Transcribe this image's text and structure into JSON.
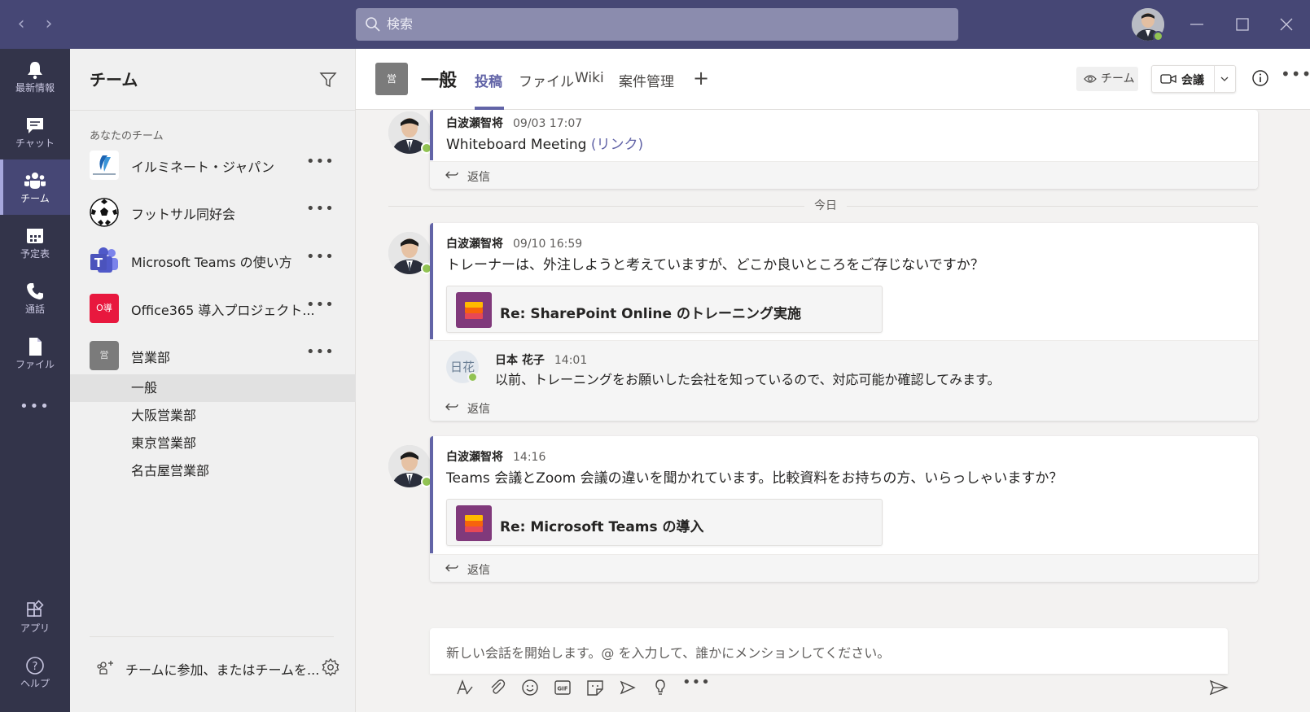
{
  "titlebar": {
    "search_placeholder": "検索"
  },
  "appbar": {
    "items": [
      {
        "label": "最新情報",
        "icon": "bell-icon"
      },
      {
        "label": "チャット",
        "icon": "chat-icon"
      },
      {
        "label": "チーム",
        "icon": "teams-icon"
      },
      {
        "label": "予定表",
        "icon": "calendar-icon"
      },
      {
        "label": "通話",
        "icon": "phone-icon"
      },
      {
        "label": "ファイル",
        "icon": "file-icon"
      }
    ],
    "more": "•••",
    "bottom": [
      {
        "label": "アプリ",
        "icon": "apps-icon"
      },
      {
        "label": "ヘルプ",
        "icon": "help-icon"
      }
    ]
  },
  "teams_panel": {
    "title": "チーム",
    "section_label": "あなたのチーム",
    "teams": [
      {
        "name": "イルミネート・ジャパン",
        "more": "•••"
      },
      {
        "name": "フットサル同好会",
        "more": "•••"
      },
      {
        "name": "Microsoft Teams の使い方",
        "more": "•••"
      },
      {
        "name": "Office365 導入プロジェクト...",
        "more": "•••",
        "logo_text": "O導"
      },
      {
        "name": "営業部",
        "more": "•••",
        "logo_text": "営"
      }
    ],
    "channels": [
      "一般",
      "大阪営業部",
      "東京営業部",
      "名古屋営業部"
    ],
    "join_text": "チームに参加、またはチームを..."
  },
  "channel_header": {
    "badge": "営",
    "name": "一般",
    "tabs": [
      "投稿",
      "ファイル",
      "Wiki",
      "案件管理"
    ],
    "add_tab": "+",
    "team_button": "チーム",
    "meet_button": "会議",
    "more": "•••"
  },
  "messages": {
    "date_separator": "今日",
    "reply_label": "返信",
    "posts": [
      {
        "author": "白波瀬智将",
        "time": "09/03 17:07",
        "text": "Whiteboard Meeting",
        "link": "(リンク)"
      },
      {
        "author": "白波瀬智将",
        "time": "09/10 16:59",
        "text": "トレーナーは、外注しようと考えていますが、どこか良いところをご存じないですか？",
        "attachment": "Re: SharePoint Online のトレーニング実施",
        "reply": {
          "author": "日本 花子",
          "time": "14:01",
          "avatar_text": "日花",
          "text": "以前、トレーニングをお願いした会社を知っているので、対応可能か確認してみます。"
        }
      },
      {
        "author": "白波瀬智将",
        "time": "14:16",
        "text": "Teams 会議とZoom 会議の違いを聞かれています。比較資料をお持ちの方、いらっしゃいますか？",
        "attachment": "Re: Microsoft Teams の導入"
      }
    ]
  },
  "compose": {
    "placeholder": "新しい会話を開始します。@ を入力して、誰かにメンションしてください。"
  },
  "colors": {
    "titlebar": "#464775",
    "appbar": "#33344a",
    "accent": "#6264a7",
    "presence": "#92c353"
  }
}
